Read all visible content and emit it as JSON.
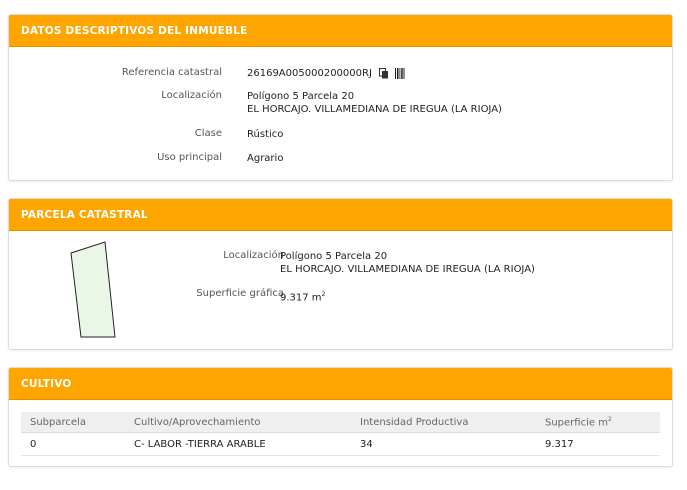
{
  "panel1": {
    "title": "DATOS DESCRIPTIVOS DEL INMUEBLE",
    "ref_label": "Referencia catastral",
    "ref_value": "26169A005000200000RJ",
    "loc_label": "Localización",
    "loc_line1": "Polígono 5 Parcela 20",
    "loc_line2": "EL HORCAJO. VILLAMEDIANA DE IREGUA (LA RIOJA)",
    "clase_label": "Clase",
    "clase_value": "Rústico",
    "uso_label": "Uso principal",
    "uso_value": "Agrario"
  },
  "panel2": {
    "title": "PARCELA CATASTRAL",
    "loc_label": "Localización",
    "loc_line1": "Polígono 5 Parcela 20",
    "loc_line2": "EL HORCAJO. VILLAMEDIANA DE IREGUA (LA RIOJA)",
    "sup_label": "Superficie gráfica",
    "sup_value": "9.317 m",
    "sup_exp": "2"
  },
  "panel3": {
    "title": "CULTIVO",
    "headers": [
      "Subparcela",
      "Cultivo/Aprovechamiento",
      "Intensidad Productiva",
      "Superficie m"
    ],
    "header_exp": "2",
    "rows": [
      [
        "0",
        "C- LABOR -TIERRA ARABLE",
        "34",
        "9.317"
      ]
    ]
  },
  "colors": {
    "header_orange": "#ffa500",
    "parcel_fill": "#eaf7e6"
  },
  "icons": [
    "copy-icon",
    "barcode-icon"
  ]
}
